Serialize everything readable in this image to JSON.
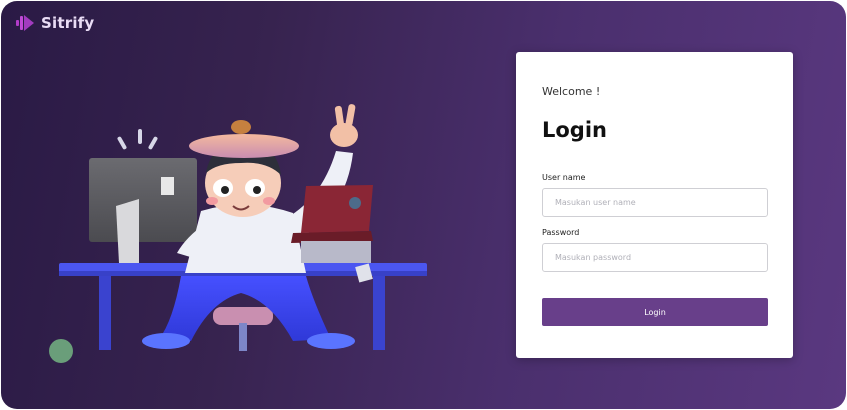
{
  "brand": {
    "name": "Sitrify"
  },
  "login_card": {
    "welcome": "Welcome !",
    "title": "Login",
    "username_label": "User name",
    "username_placeholder": "Masukan user name",
    "password_label": "Password",
    "password_placeholder": "Masukan password",
    "submit_label": "Login"
  },
  "colors": {
    "accent": "#683f8a",
    "background_start": "#2a1a45",
    "background_end": "#5a3880"
  }
}
